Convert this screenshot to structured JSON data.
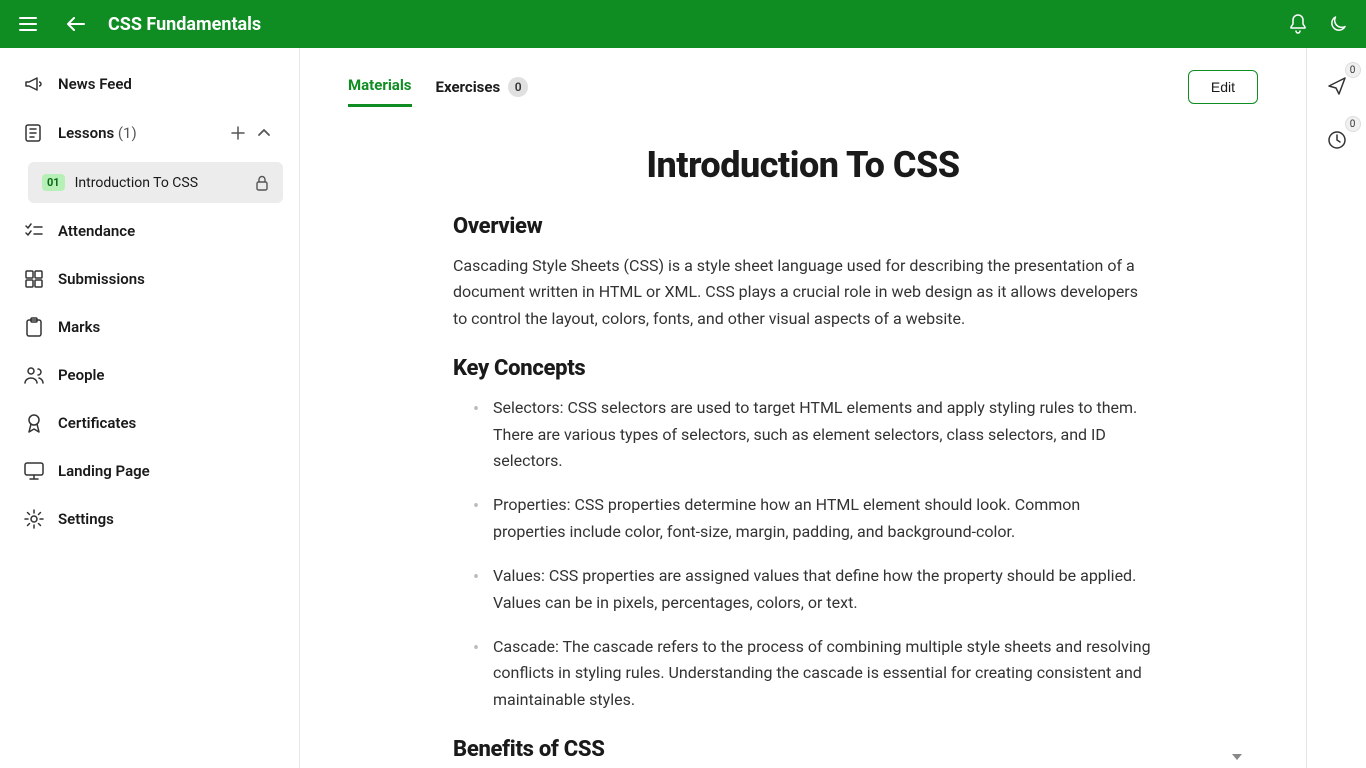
{
  "header": {
    "title": "CSS Fundamentals"
  },
  "sidebar": {
    "news_feed": "News Feed",
    "lessons_label": "Lessons",
    "lessons_count": "(1)",
    "lesson1_num": "01",
    "lesson1_name": "Introduction To CSS",
    "attendance": "Attendance",
    "submissions": "Submissions",
    "marks": "Marks",
    "people": "People",
    "certificates": "Certificates",
    "landing": "Landing Page",
    "settings": "Settings"
  },
  "tabs": {
    "materials": "Materials",
    "exercises": "Exercises",
    "exercises_count": "0",
    "edit": "Edit"
  },
  "doc": {
    "title": "Introduction To CSS",
    "h_overview": "Overview",
    "p_overview": "Cascading Style Sheets (CSS) is a style sheet language used for describing the presentation of a document written in HTML or XML. CSS plays a crucial role in web design as it allows developers to control the layout, colors, fonts, and other visual aspects of a website.",
    "h_key": "Key Concepts",
    "li1": "Selectors: CSS selectors are used to target HTML elements and apply styling rules to them. There are various types of selectors, such as element selectors, class selectors, and ID selectors.",
    "li2": "Properties: CSS properties determine how an HTML element should look. Common properties include color, font-size, margin, padding, and background-color.",
    "li3": "Values: CSS properties are assigned values that define how the property should be applied. Values can be in pixels, percentages, colors, or text.",
    "li4": "Cascade: The cascade refers to the process of combining multiple style sheets and resolving conflicts in styling rules. Understanding the cascade is essential for creating consistent and maintainable styles.",
    "h_benefits": "Benefits of CSS"
  },
  "rail": {
    "send_badge": "0",
    "clock_badge": "0"
  }
}
